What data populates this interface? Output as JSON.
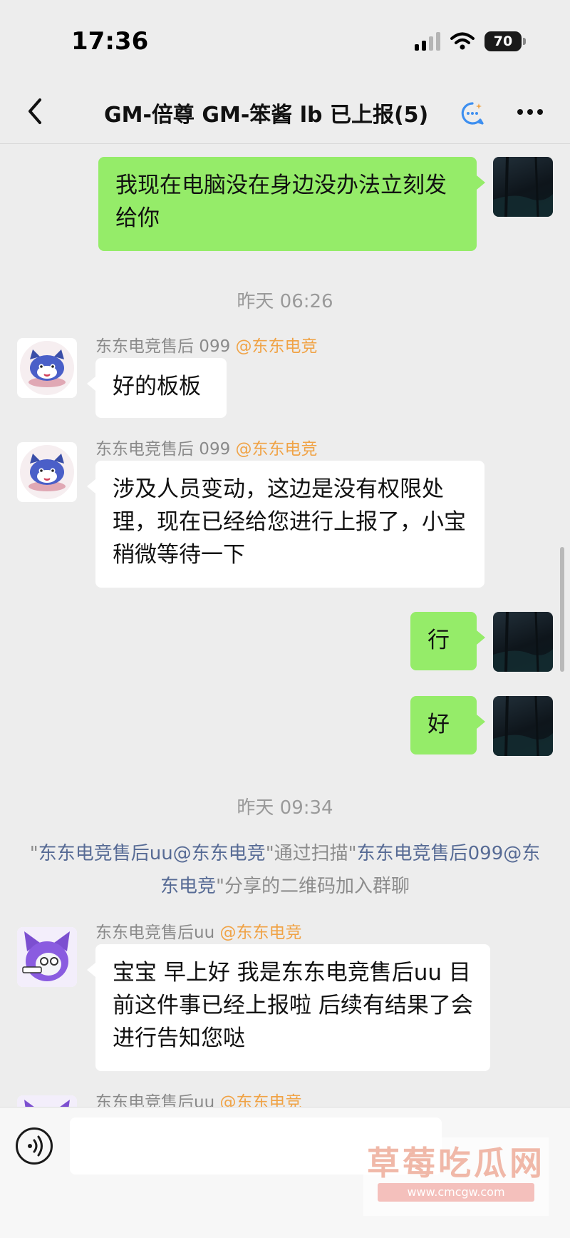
{
  "status_bar": {
    "time": "17:36",
    "battery": "70"
  },
  "nav": {
    "title": "GM-倍尊 GM-笨酱  lb 已上报(5)"
  },
  "timestamps": {
    "first": "昨天 06:26",
    "second": "昨天 09:34"
  },
  "messages": {
    "m1": {
      "text": "我现在电脑没在身边没办法立刻发给你"
    },
    "m2": {
      "sender": "东东电竞售后 099",
      "mention": "@东东电竞",
      "text": "好的板板"
    },
    "m3": {
      "sender": "东东电竞售后 099",
      "mention": "@东东电竞",
      "text": "涉及人员变动，这边是没有权限处理，现在已经给您进行上报了，小宝稍微等待一下"
    },
    "m4": {
      "text": "行"
    },
    "m5": {
      "text": "好"
    },
    "m6": {
      "sender": "东东电竞售后uu",
      "mention": "@东东电竞",
      "text": "宝宝 早上好 我是东东电竞售后uu 目前这件事已经上报啦 后续有结果了会进行告知您哒"
    },
    "m7": {
      "sender": "东东电竞售后uu",
      "mention": "@东东电竞"
    }
  },
  "system": {
    "q1": "\"",
    "name1": "东东电竞售后uu@东东电竞",
    "q2": "\"通过扫描\"",
    "name2": "东东电竞售后099@东东电竞",
    "tail": "\"分享的二维码加入群聊"
  },
  "watermark": {
    "text": "草莓吃瓜网",
    "url": "www.cmcgw.com"
  },
  "icons": {
    "back": "chevron-left-icon",
    "ai": "ai-chat-icon",
    "more": "more-icon",
    "voice": "voice-icon",
    "signal": "signal-icon",
    "wifi": "wifi-icon",
    "battery": "battery-icon"
  },
  "colors": {
    "background": "#ededed",
    "bubble_self": "#95ec69",
    "bubble_other": "#ffffff",
    "mention": "#f0a346",
    "link": "#576b95"
  }
}
